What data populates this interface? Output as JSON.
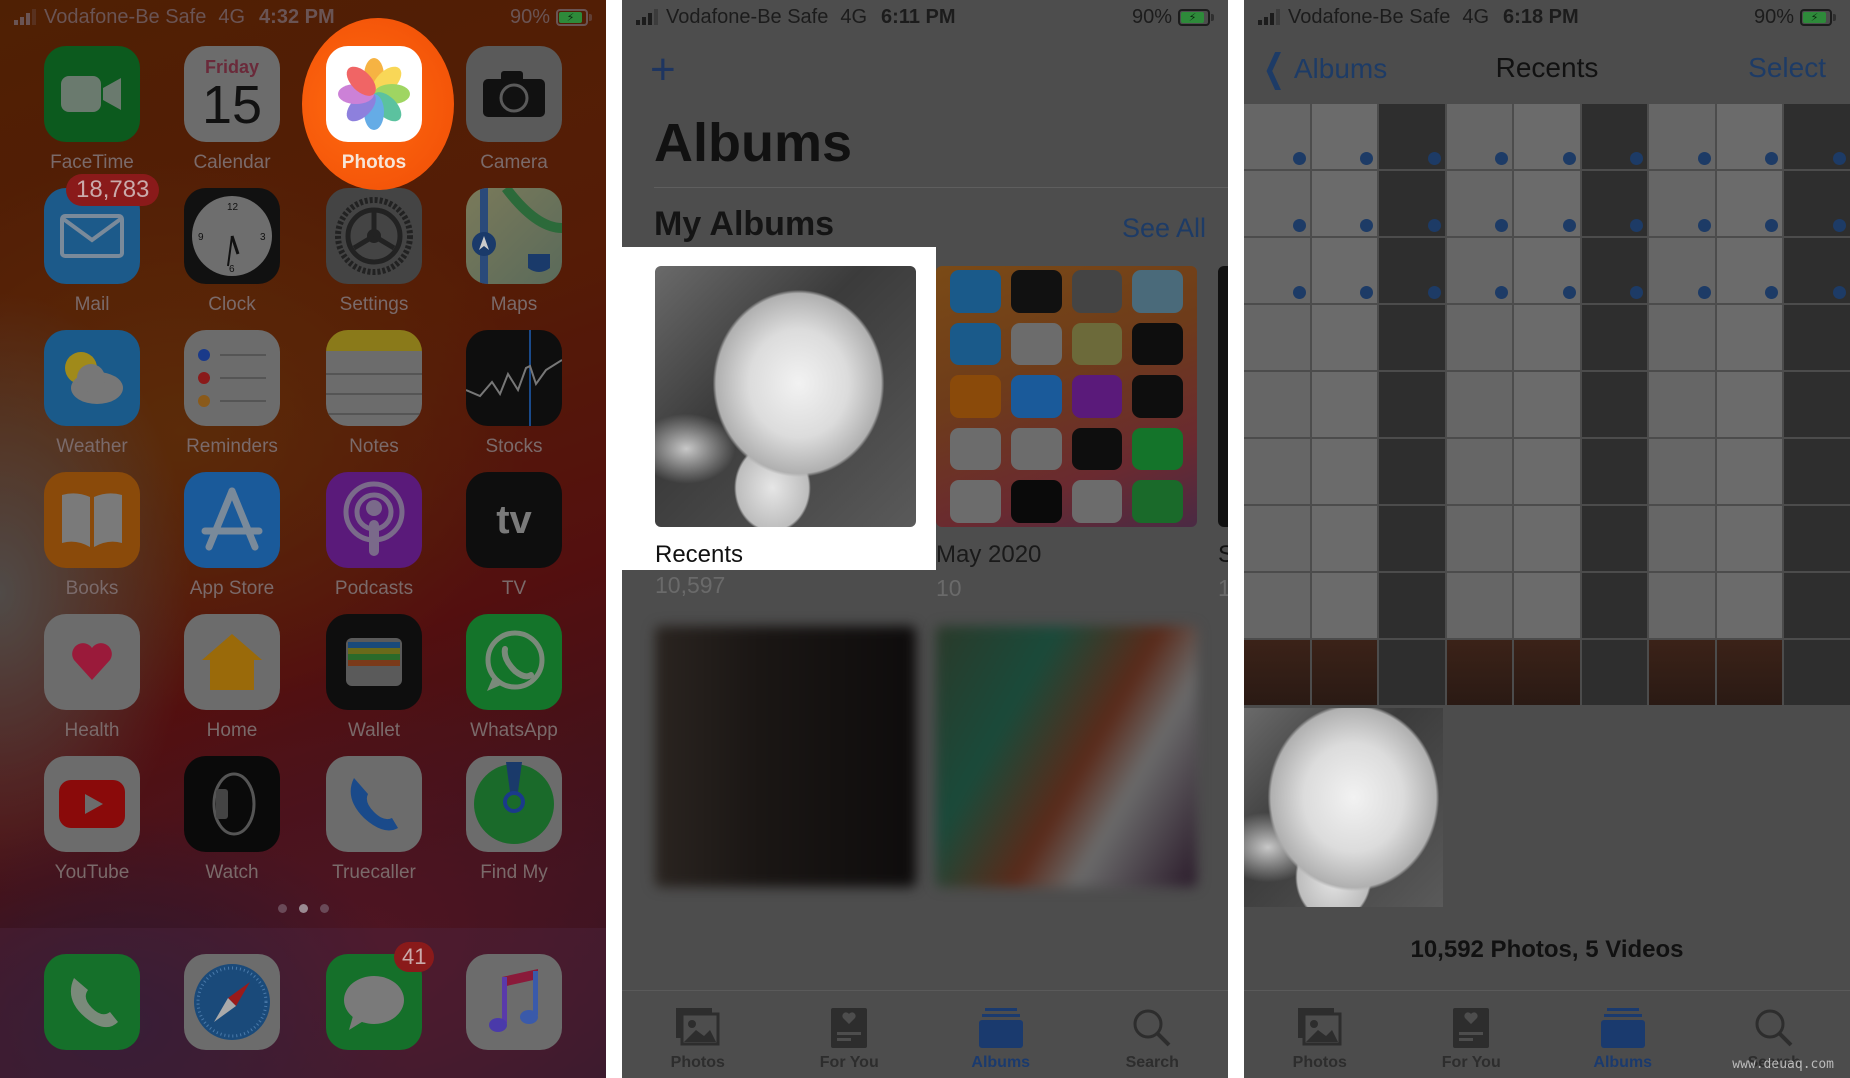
{
  "home": {
    "status": {
      "carrier": "Vodafone-Be Safe",
      "network": "4G",
      "time": "4:32 PM",
      "battery": "90%"
    },
    "apps": [
      {
        "label": "FaceTime",
        "icon": "facetime-icon"
      },
      {
        "label": "Calendar",
        "icon": "calendar-icon",
        "weekday": "Friday",
        "day": "15"
      },
      {
        "label": "Photos",
        "icon": "photos-icon",
        "highlighted": true
      },
      {
        "label": "Camera",
        "icon": "camera-icon"
      },
      {
        "label": "Mail",
        "icon": "mail-icon",
        "badge": "18,783"
      },
      {
        "label": "Clock",
        "icon": "clock-icon"
      },
      {
        "label": "Settings",
        "icon": "settings-icon"
      },
      {
        "label": "Maps",
        "icon": "maps-icon"
      },
      {
        "label": "Weather",
        "icon": "weather-icon"
      },
      {
        "label": "Reminders",
        "icon": "reminders-icon"
      },
      {
        "label": "Notes",
        "icon": "notes-icon"
      },
      {
        "label": "Stocks",
        "icon": "stocks-icon"
      },
      {
        "label": "Books",
        "icon": "books-icon"
      },
      {
        "label": "App Store",
        "icon": "app-store-icon"
      },
      {
        "label": "Podcasts",
        "icon": "podcasts-icon"
      },
      {
        "label": "TV",
        "icon": "tv-icon",
        "glyph": "tv"
      },
      {
        "label": "Health",
        "icon": "health-icon"
      },
      {
        "label": "Home",
        "icon": "home-icon"
      },
      {
        "label": "Wallet",
        "icon": "wallet-icon"
      },
      {
        "label": "WhatsApp",
        "icon": "whatsapp-icon"
      },
      {
        "label": "YouTube",
        "icon": "youtube-icon"
      },
      {
        "label": "Watch",
        "icon": "watch-icon"
      },
      {
        "label": "Truecaller",
        "icon": "truecaller-icon"
      },
      {
        "label": "Find My",
        "icon": "find-my-icon"
      }
    ],
    "page_dots": {
      "count": 3,
      "active": 2
    },
    "dock": [
      {
        "icon": "phone-icon"
      },
      {
        "icon": "safari-icon"
      },
      {
        "icon": "messages-icon",
        "badge": "41"
      },
      {
        "icon": "music-icon"
      }
    ]
  },
  "albums": {
    "status": {
      "carrier": "Vodafone-Be Safe",
      "network": "4G",
      "time": "6:11 PM",
      "battery": "90%"
    },
    "add_symbol": "+",
    "title": "Albums",
    "section_title": "My Albums",
    "see_all": "See All",
    "items": [
      {
        "name": "Recents",
        "count": "10,597",
        "highlighted": true
      },
      {
        "name": "May 2020",
        "count": "10"
      },
      {
        "name": "S",
        "count": "1"
      }
    ]
  },
  "recents": {
    "status": {
      "carrier": "Vodafone-Be Safe",
      "network": "4G",
      "time": "6:18 PM",
      "battery": "90%"
    },
    "back_label": "Albums",
    "title": "Recents",
    "select_label": "Select",
    "summary": "10,592 Photos, 5 Videos"
  },
  "tabbar": [
    {
      "label": "Photos",
      "icon": "photos-tab-icon"
    },
    {
      "label": "For You",
      "icon": "for-you-tab-icon"
    },
    {
      "label": "Albums",
      "icon": "albums-tab-icon",
      "active": true
    },
    {
      "label": "Search",
      "icon": "search-tab-icon"
    }
  ],
  "watermark": "www.deuaq.com"
}
